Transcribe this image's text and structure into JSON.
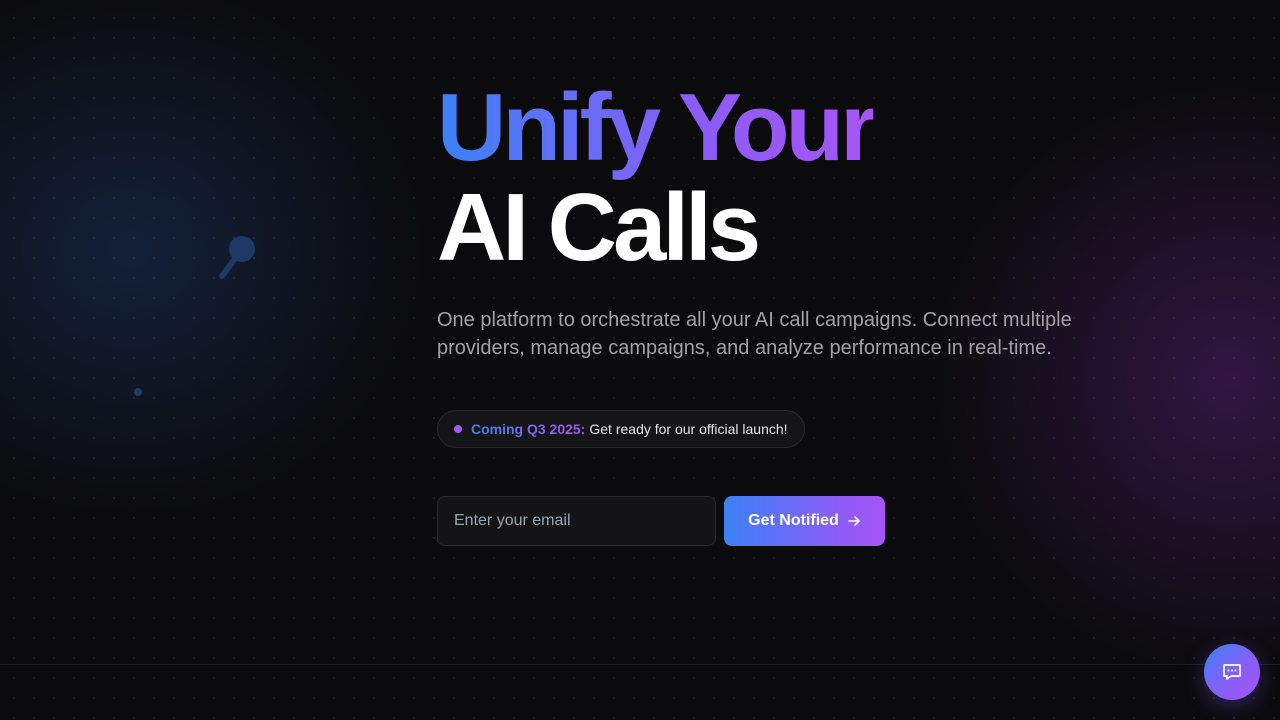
{
  "hero": {
    "headline_line1": "Unify Your",
    "headline_line2": "AI Calls",
    "subtitle": "One platform to orchestrate all your AI call campaigns. Connect multiple providers, manage campaigns, and analyze performance in real-time."
  },
  "badge": {
    "highlight": "Coming Q3 2025:",
    "text": "Get ready for our official launch!"
  },
  "signup": {
    "email_placeholder": "Enter your email",
    "email_value": "",
    "button_label": "Get Notified",
    "button_icon": "arrow-right-icon"
  },
  "chat": {
    "icon": "chat-bubble-icon"
  },
  "colors": {
    "gradient_start": "#3b82f6",
    "gradient_end": "#a855f7",
    "background": "#0b0b0d",
    "subtitle": "#a1a1aa"
  }
}
